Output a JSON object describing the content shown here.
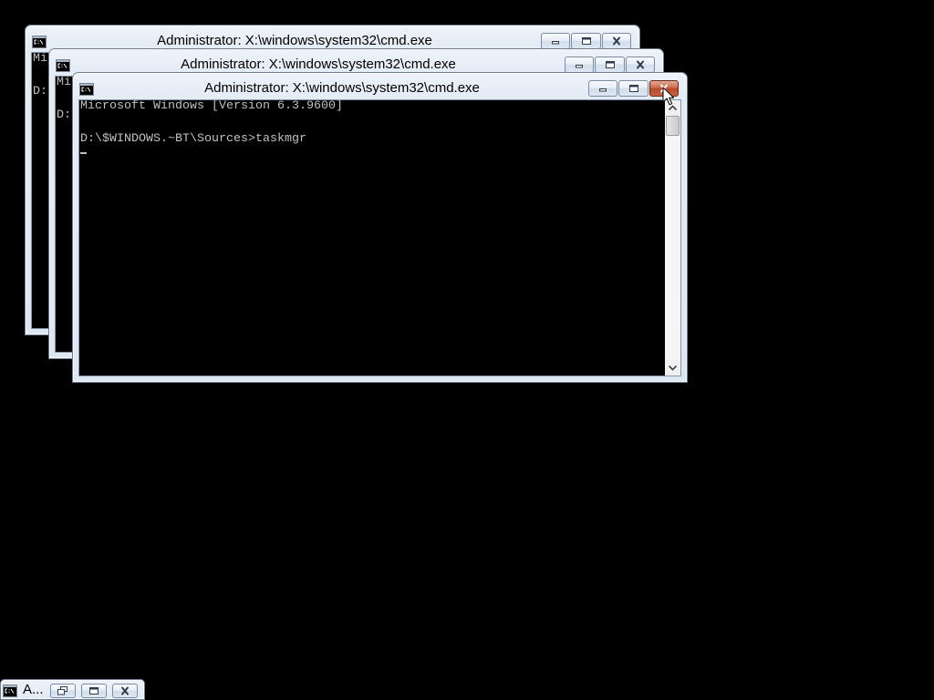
{
  "desktop": {
    "background": "#000000"
  },
  "colors": {
    "frame": "#d9e4f1",
    "console_text": "#c0c0c0",
    "close_hover": "#c4502c"
  },
  "windows": [
    {
      "title": "Administrator: X:\\windows\\system32\\cmd.exe",
      "icon": "console-icon",
      "active": false,
      "caption_buttons": [
        "minimize-icon",
        "maximize-icon",
        "close-icon"
      ],
      "console": {
        "banner": "Mi",
        "command": "D:"
      }
    },
    {
      "title": "Administrator: X:\\windows\\system32\\cmd.exe",
      "icon": "console-icon",
      "active": false,
      "caption_buttons": [
        "minimize-icon",
        "maximize-icon",
        "close-icon"
      ],
      "console": {
        "banner": "Mi",
        "command": "D:"
      }
    },
    {
      "title": "Administrator: X:\\windows\\system32\\cmd.exe",
      "icon": "console-icon",
      "active": true,
      "caption_buttons": [
        "minimize-icon",
        "maximize-icon",
        "close-icon"
      ],
      "close_button_hovered": true,
      "console": {
        "banner": "Microsoft Windows [Version 6.3.9600]",
        "command": "D:\\$WINDOWS.~BT\\Sources>taskmgr"
      },
      "scrollbar": {
        "position_percent": 0
      }
    }
  ],
  "minimized_window": {
    "title": "A...",
    "icon": "console-icon",
    "buttons": [
      "restore-icon",
      "maximize-icon",
      "close-icon"
    ]
  },
  "pointer": {
    "icon": "arrow-cursor-icon"
  }
}
